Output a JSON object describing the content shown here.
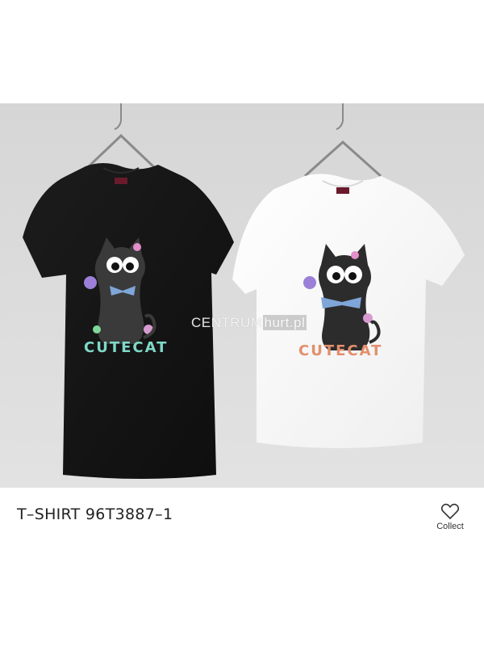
{
  "product": {
    "title": "T–SHIRT 96T3887–1",
    "image_alt": "Two t-shirts on hangers with cute black cat print",
    "watermark_main": "CENTRUM",
    "watermark_accent": "hurt.pl",
    "print_text": "CUTECAT"
  },
  "actions": {
    "collect_label": "Collect",
    "collect_icon": "heart-outline-icon"
  },
  "colors": {
    "background_gray": "#dcdcdc",
    "shirt_black": "#151515",
    "shirt_white": "#f7f7f7"
  }
}
